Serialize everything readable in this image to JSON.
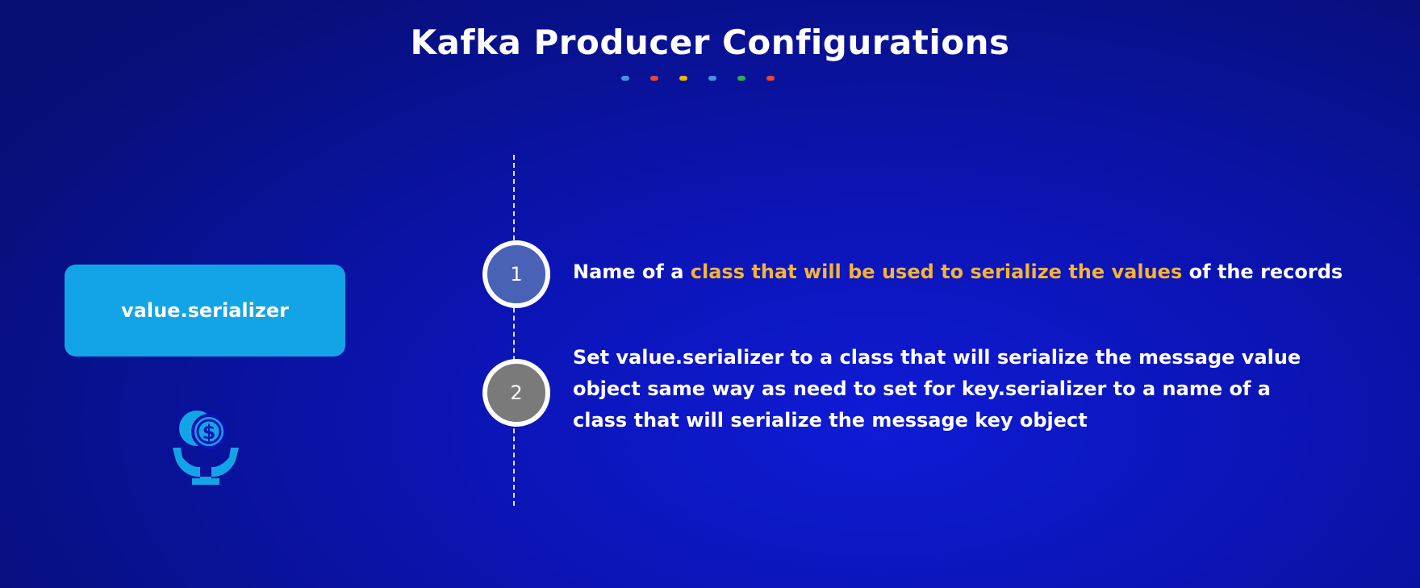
{
  "title": "Kafka Producer Configurations",
  "title_dots": [
    "#4a90e2",
    "#e8453c",
    "#f4b400",
    "#4a90e2",
    "#34a853",
    "#e8453c"
  ],
  "config": {
    "name": "value.serializer",
    "icon": "money-hand-icon"
  },
  "steps": [
    {
      "number": "1",
      "text_before": "Name of a ",
      "text_highlight": "class that will be used to serialize the values",
      "text_after": " of the records"
    },
    {
      "number": "2",
      "lines": [
        "Set value.serializer to a class that will serialize the message value",
        "object same way as need to set for key.serializer to a name of a",
        "class that will serialize the message key object"
      ]
    }
  ],
  "colors": {
    "card": "#13a4e8",
    "highlight": "#f5b437",
    "badge_1": "#4a62b6",
    "badge_2": "#7a7a7a"
  }
}
